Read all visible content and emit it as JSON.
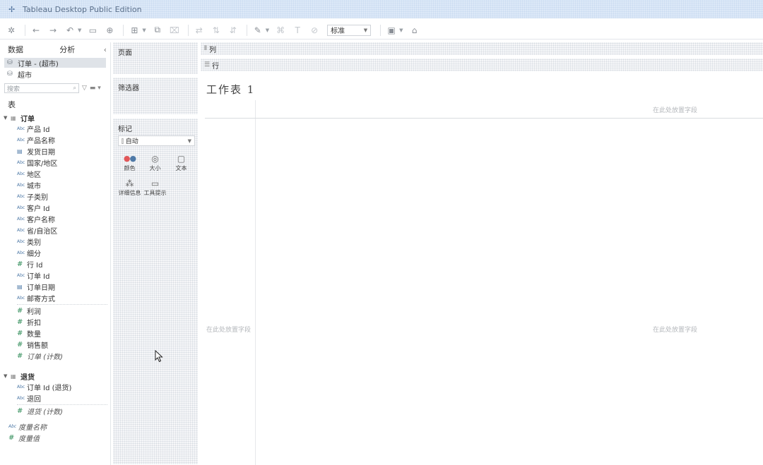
{
  "app": {
    "title": "Tableau Desktop Public Edition"
  },
  "toolbar": {
    "fit_value": "标准",
    "icons": [
      "tableau-logo-icon",
      "undo-icon",
      "redo-icon",
      "dropdown-icon",
      "save-icon",
      "new-datasource-icon",
      "new-sheet-icon",
      "duplicate-sheet-icon",
      "clear-sheet-icon",
      "swap-icon",
      "sort-asc-icon",
      "sort-desc-icon",
      "highlight-icon",
      "group-icon",
      "label-icon",
      "format-icon",
      "fit-icon",
      "show-cards-icon",
      "presentation-icon"
    ]
  },
  "data_pane": {
    "tabs": [
      "数据",
      "分析"
    ],
    "datasources": [
      {
        "label": "订单 - (超市)",
        "active": true
      },
      {
        "label": "超市",
        "active": false
      }
    ],
    "search_placeholder": "搜索",
    "tables_label": "表",
    "tables": [
      {
        "name": "订单",
        "fields": [
          {
            "label": "产品 Id",
            "type": "dim"
          },
          {
            "label": "产品名称",
            "type": "dim"
          },
          {
            "label": "发货日期",
            "type": "date"
          },
          {
            "label": "国家/地区",
            "type": "dim"
          },
          {
            "label": "地区",
            "type": "dim"
          },
          {
            "label": "城市",
            "type": "dim"
          },
          {
            "label": "子类别",
            "type": "dim"
          },
          {
            "label": "客户 Id",
            "type": "dim"
          },
          {
            "label": "客户名称",
            "type": "dim"
          },
          {
            "label": "省/自治区",
            "type": "dim"
          },
          {
            "label": "类别",
            "type": "dim"
          },
          {
            "label": "细分",
            "type": "dim"
          },
          {
            "label": "行 Id",
            "type": "meas"
          },
          {
            "label": "订单 Id",
            "type": "dim"
          },
          {
            "label": "订单日期",
            "type": "date"
          },
          {
            "label": "邮寄方式",
            "type": "dim"
          }
        ],
        "measures": [
          {
            "label": "利润",
            "type": "meas"
          },
          {
            "label": "折扣",
            "type": "meas"
          },
          {
            "label": "数量",
            "type": "meas"
          },
          {
            "label": "销售额",
            "type": "meas"
          },
          {
            "label": "订单 (计数)",
            "type": "meas",
            "italic": true
          }
        ]
      },
      {
        "name": "退货",
        "fields": [
          {
            "label": "订单 Id (退货)",
            "type": "dim"
          },
          {
            "label": "退回",
            "type": "dim"
          }
        ],
        "measures": [
          {
            "label": "退货 (计数)",
            "type": "meas",
            "italic": true
          }
        ]
      }
    ],
    "root_fields": [
      {
        "label": "度量名称",
        "type": "dim"
      },
      {
        "label": "度量值",
        "type": "meas"
      }
    ]
  },
  "cards": {
    "pages": "页面",
    "filters": "筛选器",
    "marks": "标记",
    "marks_type": "自动",
    "mark_buttons": [
      {
        "label": "颜色",
        "icon": "color-icon"
      },
      {
        "label": "大小",
        "icon": "size-icon"
      },
      {
        "label": "文本",
        "icon": "text-icon"
      },
      {
        "label": "详细信息",
        "icon": "detail-icon"
      },
      {
        "label": "工具提示",
        "icon": "tooltip-icon"
      }
    ]
  },
  "shelves": {
    "columns": "列",
    "rows": "行"
  },
  "sheet": {
    "title": "工作表 1",
    "drop_hint_cols": "在此处放置字段",
    "drop_hint_rows": "在此处放置字段",
    "drop_hint_center": "在此处放置字段"
  }
}
